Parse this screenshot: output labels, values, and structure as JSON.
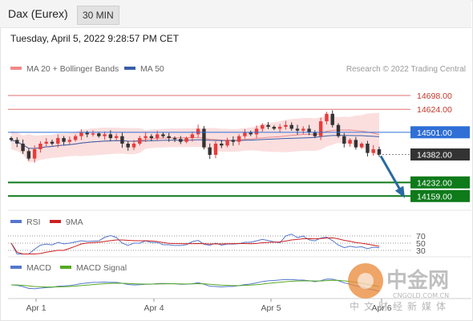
{
  "header": {
    "title": "Dax (Eurex)",
    "timeframe": "30 MIN"
  },
  "datetime": "Tuesday, April 5, 2022 9:28:57 PM CET",
  "legend": {
    "bollinger": "MA 20 + Bollinger Bands",
    "ma50": "MA 50",
    "credit": "Research © 2022 Trading Central"
  },
  "levels": [
    {
      "label": "14698.00",
      "style": "resistance-thin"
    },
    {
      "label": "14624.00",
      "style": "resistance-thin"
    },
    {
      "label": "14501.00",
      "style": "pivot"
    },
    {
      "label": "14382.00",
      "style": "last"
    },
    {
      "label": "14232.00",
      "style": "target"
    },
    {
      "label": "14159.00",
      "style": "target"
    }
  ],
  "rsi": {
    "label": "RSI",
    "ma_label": "9MA",
    "levels": [
      "70",
      "50",
      "30"
    ]
  },
  "macd": {
    "label": "MACD",
    "signal_label": "MACD Signal"
  },
  "xaxis": {
    "ticks": [
      "Apr 1",
      "Apr 4",
      "Apr 5",
      "Apr 6"
    ]
  },
  "watermark": {
    "cn": "中金网",
    "url": "CNGOLD.COM.CN",
    "slogan": "中文财经新媒体"
  },
  "colors": {
    "up": "#e83c3c",
    "down": "#333333",
    "bb": "#f9caca",
    "ma20": "#e88a8a",
    "ma50": "#3a5fa8",
    "pivot": "#2f6fd6",
    "target": "#0e7a1a",
    "resistance": "#e07070",
    "rsi": "#5577cc",
    "rsi_ma": "#cc2222",
    "macd": "#5577cc",
    "macd_signal": "#55aa22"
  },
  "chart_data": {
    "type": "candlestick",
    "symbol": "Dax (Eurex)",
    "interval": "30 MIN",
    "y_range": [
      14100,
      14780
    ],
    "x_ticks": [
      "Apr 1",
      "Apr 4",
      "Apr 5",
      "Apr 6"
    ],
    "levels": [
      14698.0,
      14624.0,
      14501.0,
      14382.0,
      14232.0,
      14159.0
    ],
    "last_price": 14382.0,
    "projection": {
      "from": 14382.0,
      "to": 14232.0,
      "direction": "down"
    },
    "closes": [
      14460,
      14440,
      14400,
      14360,
      14410,
      14440,
      14450,
      14440,
      14470,
      14450,
      14460,
      14480,
      14500,
      14490,
      14495,
      14480,
      14490,
      14470,
      14480,
      14440,
      14420,
      14440,
      14470,
      14480,
      14470,
      14490,
      14480,
      14470,
      14465,
      14450,
      14470,
      14490,
      14520,
      14420,
      14380,
      14440,
      14430,
      14460,
      14450,
      14480,
      14500,
      14490,
      14520,
      14540,
      14530,
      14520,
      14530,
      14540,
      14520,
      14510,
      14520,
      14500,
      14480,
      14560,
      14600,
      14540,
      14480,
      14440,
      14460,
      14420,
      14440,
      14390,
      14410,
      14380
    ],
    "opens": [
      14470,
      14460,
      14440,
      14400,
      14360,
      14410,
      14440,
      14450,
      14440,
      14470,
      14450,
      14460,
      14480,
      14500,
      14490,
      14495,
      14480,
      14490,
      14470,
      14480,
      14440,
      14420,
      14440,
      14470,
      14480,
      14470,
      14490,
      14480,
      14470,
      14465,
      14450,
      14470,
      14490,
      14520,
      14420,
      14380,
      14440,
      14430,
      14460,
      14450,
      14480,
      14500,
      14490,
      14520,
      14540,
      14530,
      14520,
      14530,
      14540,
      14520,
      14510,
      14520,
      14500,
      14480,
      14560,
      14600,
      14540,
      14480,
      14440,
      14460,
      14420,
      14440,
      14390,
      14410
    ],
    "rsi_levels": [
      70,
      50,
      30
    ]
  }
}
